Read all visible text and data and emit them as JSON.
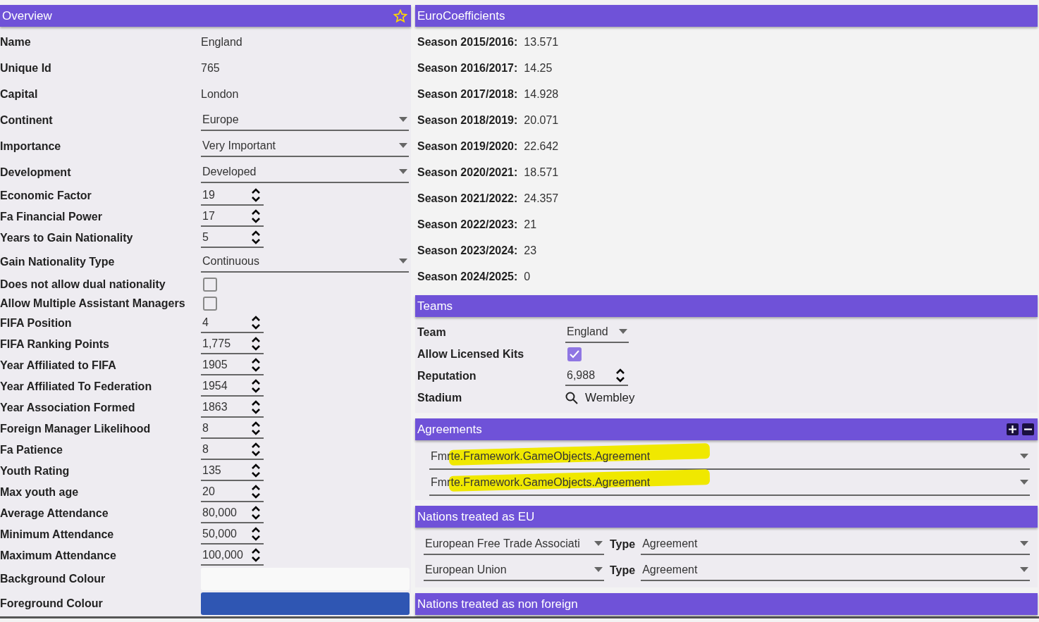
{
  "overview": {
    "title": "Overview",
    "favorite": false,
    "fields": [
      {
        "kind": "text",
        "label": "Name",
        "value": "England"
      },
      {
        "kind": "text",
        "label": "Unique Id",
        "value": "765"
      },
      {
        "kind": "text",
        "label": "Capital",
        "value": "London"
      },
      {
        "kind": "dropdown",
        "label": "Continent",
        "value": "Europe"
      },
      {
        "kind": "dropdown",
        "label": "Importance",
        "value": "Very Important"
      },
      {
        "kind": "dropdown",
        "label": "Development",
        "value": "Developed"
      },
      {
        "kind": "spinner",
        "label": "Economic Factor",
        "value": "19"
      },
      {
        "kind": "spinner",
        "label": "Fa Financial Power",
        "value": "17"
      },
      {
        "kind": "spinner",
        "label": "Years to Gain Nationality",
        "value": "5"
      },
      {
        "kind": "dropdown",
        "label": "Gain Nationality Type",
        "value": "Continuous"
      },
      {
        "kind": "checkbox",
        "label": "Does not allow dual nationality",
        "checked": false
      },
      {
        "kind": "checkbox",
        "label": "Allow Multiple Assistant Managers",
        "checked": false
      },
      {
        "kind": "spinner",
        "label": "FIFA Position",
        "value": "4"
      },
      {
        "kind": "spinner",
        "label": "FIFA Ranking Points",
        "value": "1,775"
      },
      {
        "kind": "spinner",
        "label": "Year Affiliated to FIFA",
        "value": "1905"
      },
      {
        "kind": "spinner",
        "label": "Year Affiliated To Federation",
        "value": "1954"
      },
      {
        "kind": "spinner",
        "label": "Year Association Formed",
        "value": "1863"
      },
      {
        "kind": "spinner",
        "label": "Foreign Manager Likelihood",
        "value": "8"
      },
      {
        "kind": "spinner",
        "label": "Fa Patience",
        "value": "8"
      },
      {
        "kind": "spinner",
        "label": "Youth Rating",
        "value": "135"
      },
      {
        "kind": "spinner",
        "label": "Max youth age",
        "value": "20"
      },
      {
        "kind": "spinner",
        "label": "Average Attendance",
        "value": "80,000"
      },
      {
        "kind": "spinner",
        "label": "Minimum Attendance",
        "value": "50,000"
      },
      {
        "kind": "spinner",
        "label": "Maximum Attendance",
        "value": "100,000"
      },
      {
        "kind": "color",
        "label": "Background Colour",
        "color": "#f9f9f9"
      },
      {
        "kind": "color",
        "label": "Foreground Colour",
        "color": "#2f56b3"
      }
    ]
  },
  "euro_coefficients": {
    "title": "EuroCoefficients",
    "rows": [
      {
        "label": "Season 2015/2016:",
        "value": "13.571"
      },
      {
        "label": "Season 2016/2017:",
        "value": "14.25"
      },
      {
        "label": "Season 2017/2018:",
        "value": "14.928"
      },
      {
        "label": "Season 2018/2019:",
        "value": "20.071"
      },
      {
        "label": "Season 2019/2020:",
        "value": "22.642"
      },
      {
        "label": "Season 2020/2021:",
        "value": "18.571"
      },
      {
        "label": "Season 2021/2022:",
        "value": "24.357"
      },
      {
        "label": "Season 2022/2023:",
        "value": "21"
      },
      {
        "label": "Season 2023/2024:",
        "value": "23"
      },
      {
        "label": "Season 2024/2025:",
        "value": "0"
      }
    ]
  },
  "teams": {
    "title": "Teams",
    "fields": [
      {
        "kind": "dropdown",
        "label": "Team",
        "value": "England"
      },
      {
        "kind": "checkbox",
        "label": "Allow Licensed Kits",
        "checked": true
      },
      {
        "kind": "spinner",
        "label": "Reputation",
        "value": "6,988"
      },
      {
        "kind": "search",
        "label": "Stadium",
        "value": "Wembley"
      }
    ]
  },
  "agreements": {
    "title": "Agreements",
    "items": [
      {
        "value": "Fmrte.Framework.GameObjects.Agreement",
        "highlighted": true
      },
      {
        "value": "Fmrte.Framework.GameObjects.Agreement",
        "highlighted": true
      }
    ]
  },
  "nations_eu": {
    "title": "Nations treated as EU",
    "rows": [
      {
        "nation": "European Free Trade Associati",
        "type_label": "Type",
        "type": "Agreement"
      },
      {
        "nation": "European Union",
        "type_label": "Type",
        "type": "Agreement"
      }
    ]
  },
  "nations_non_foreign": {
    "title": "Nations treated as non foreign"
  }
}
